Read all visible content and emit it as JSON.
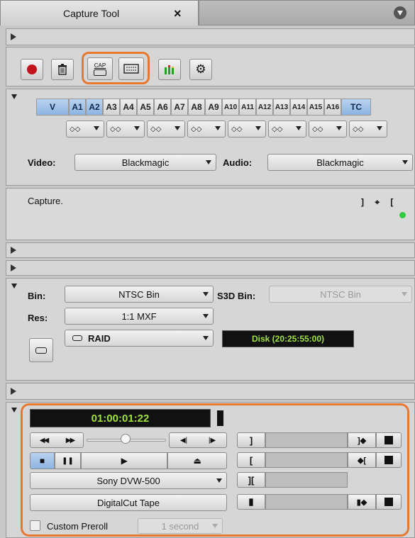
{
  "tab": {
    "title": "Capture Tool",
    "close": "×"
  },
  "toolbar": {
    "record_icon": "record-icon",
    "trash_icon": "trash-icon",
    "cap_label": "CAP",
    "deck_icon": "deck-icon",
    "meter_icon": "audio-meter-icon",
    "settings_icon": "gear-icon",
    "highlight_color": "#e8782f"
  },
  "tracks": {
    "video": "V",
    "audio": [
      "A1",
      "A2",
      "A3",
      "A4",
      "A5",
      "A6",
      "A7",
      "A8",
      "A9",
      "A10",
      "A11",
      "A12",
      "A13",
      "A14",
      "A15",
      "A16"
    ],
    "timecode": "TC",
    "selected": [
      "V",
      "A1",
      "A2",
      "TC"
    ],
    "pairs": [
      "◇◇",
      "◇◇",
      "◇◇",
      "◇◇",
      "◇◇",
      "◇◇",
      "◇◇",
      "◇◇"
    ]
  },
  "source": {
    "video_label": "Video:",
    "video_value": "Blackmagic",
    "audio_label": "Audio:",
    "audio_value": "Blackmagic"
  },
  "message": {
    "text": "Capture.",
    "indicators": "] ⌖ [",
    "status_color": "#2ecc40"
  },
  "target": {
    "bin_label": "Bin:",
    "bin_value": "NTSC Bin",
    "s3d_label": "S3D Bin:",
    "s3d_value": "NTSC Bin",
    "res_label": "Res:",
    "res_value": "1:1  MXF",
    "drive_value": "RAID",
    "disk_status": "Disk (20:25:55:00)"
  },
  "deck": {
    "timecode": "01:00:01:22",
    "deck_name": "Sony DVW-500",
    "tape_name": "DigitalCut Tape",
    "preroll_label": "Custom Preroll",
    "preroll_value": "1 second",
    "rew": "◀◀",
    "ff": "▶▶",
    "step_back": "◀|",
    "step_fwd": "|▶",
    "stop": "■",
    "pause": "❚❚",
    "play": "▶",
    "eject": "⏏"
  }
}
